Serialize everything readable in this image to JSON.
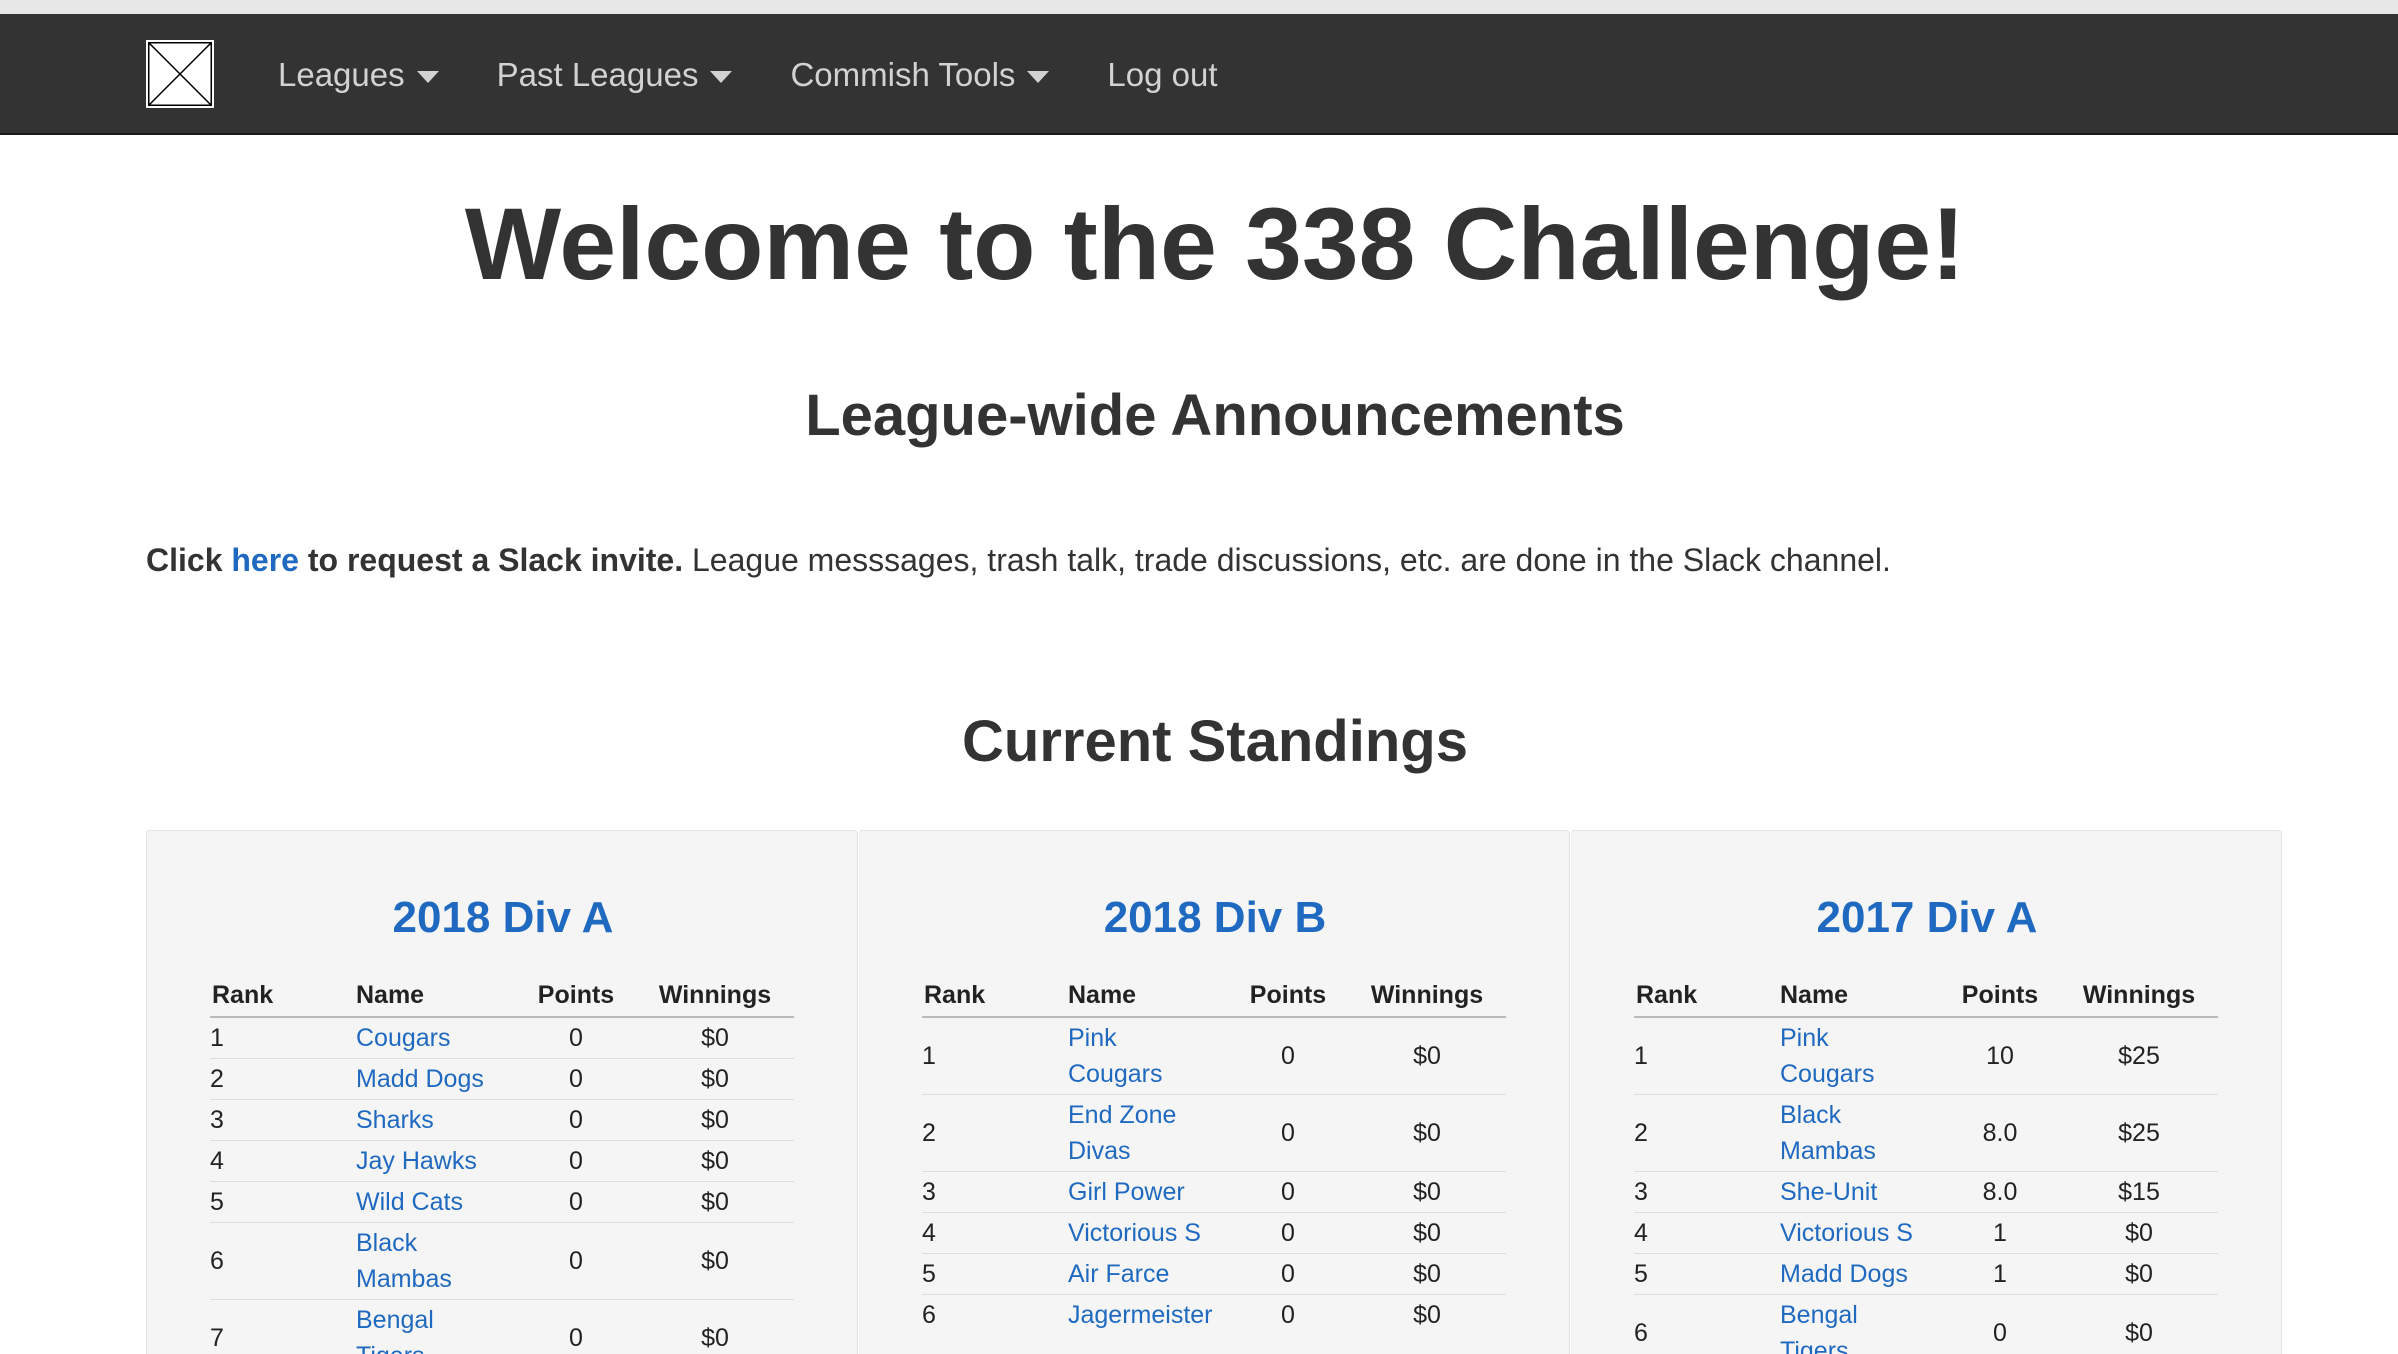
{
  "nav": {
    "items": [
      {
        "label": "Leagues",
        "dropdown": true
      },
      {
        "label": "Past Leagues",
        "dropdown": true
      },
      {
        "label": "Commish Tools",
        "dropdown": true
      },
      {
        "label": "Log out",
        "dropdown": false
      }
    ]
  },
  "page": {
    "title": "Welcome to the 338 Challenge!",
    "announcements_heading": "League-wide Announcements",
    "announcement": {
      "click": "Click",
      "link": "here",
      "bold_rest": "to request a Slack invite.",
      "rest": "League messsages, trash talk, trade discussions, etc. are done in the Slack channel."
    },
    "standings_heading": "Current Standings"
  },
  "table_headers": {
    "rank": "Rank",
    "name": "Name",
    "points": "Points",
    "winnings": "Winnings"
  },
  "divisions": [
    {
      "title": "2018 Div A",
      "rows": [
        {
          "rank": "1",
          "name": "Cougars",
          "points": "0",
          "winnings": "$0"
        },
        {
          "rank": "2",
          "name": "Madd Dogs",
          "points": "0",
          "winnings": "$0"
        },
        {
          "rank": "3",
          "name": "Sharks",
          "points": "0",
          "winnings": "$0"
        },
        {
          "rank": "4",
          "name": "Jay Hawks",
          "points": "0",
          "winnings": "$0"
        },
        {
          "rank": "5",
          "name": "Wild Cats",
          "points": "0",
          "winnings": "$0"
        },
        {
          "rank": "6",
          "name": "Black Mambas",
          "points": "0",
          "winnings": "$0"
        },
        {
          "rank": "7",
          "name": "Bengal Tigers",
          "points": "0",
          "winnings": "$0"
        }
      ]
    },
    {
      "title": "2018 Div B",
      "rows": [
        {
          "rank": "1",
          "name": "Pink Cougars",
          "points": "0",
          "winnings": "$0"
        },
        {
          "rank": "2",
          "name": "End Zone Divas",
          "points": "0",
          "winnings": "$0"
        },
        {
          "rank": "3",
          "name": "Girl Power",
          "points": "0",
          "winnings": "$0"
        },
        {
          "rank": "4",
          "name": "Victorious S",
          "points": "0",
          "winnings": "$0"
        },
        {
          "rank": "5",
          "name": "Air Farce",
          "points": "0",
          "winnings": "$0"
        },
        {
          "rank": "6",
          "name": "Jagermeister",
          "points": "0",
          "winnings": "$0"
        }
      ]
    },
    {
      "title": "2017 Div A",
      "rows": [
        {
          "rank": "1",
          "name": "Pink Cougars",
          "points": "10",
          "winnings": "$25"
        },
        {
          "rank": "2",
          "name": "Black Mambas",
          "points": "8.0",
          "winnings": "$25"
        },
        {
          "rank": "3",
          "name": "She-Unit",
          "points": "8.0",
          "winnings": "$15"
        },
        {
          "rank": "4",
          "name": "Victorious S",
          "points": "1",
          "winnings": "$0"
        },
        {
          "rank": "5",
          "name": "Madd Dogs",
          "points": "1",
          "winnings": "$0"
        },
        {
          "rank": "6",
          "name": "Bengal Tigers",
          "points": "0",
          "winnings": "$0"
        }
      ]
    }
  ],
  "colors": {
    "navbar": "#333333",
    "link": "#1f6ac0",
    "panel": "#f5f5f5"
  }
}
